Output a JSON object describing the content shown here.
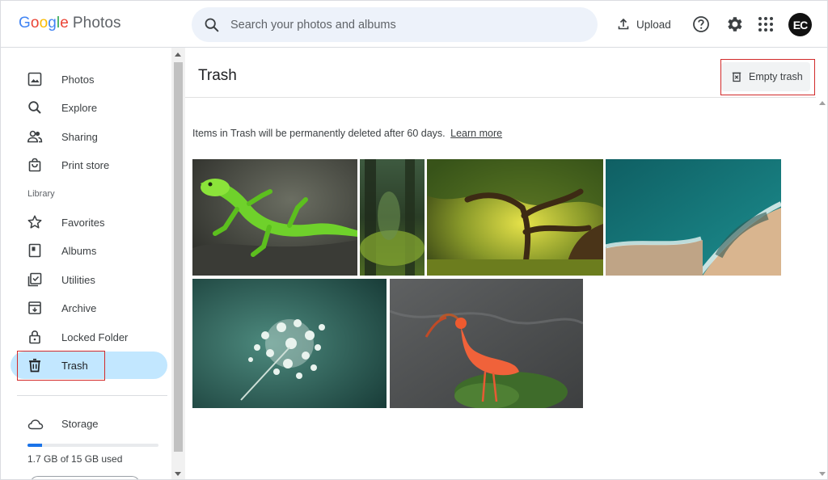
{
  "app": {
    "logo_letters": [
      "G",
      "o",
      "o",
      "g",
      "l",
      "e"
    ],
    "product": "Photos"
  },
  "header": {
    "search_placeholder": "Search your photos and albums",
    "upload_label": "Upload",
    "icons": [
      "search-icon",
      "upload-icon",
      "help-icon",
      "settings-icon",
      "apps-grid-icon"
    ],
    "avatar_initials": "EC"
  },
  "sidebar": {
    "items": [
      {
        "label": "Photos",
        "icon": "photos-icon"
      },
      {
        "label": "Explore",
        "icon": "search-icon"
      },
      {
        "label": "Sharing",
        "icon": "people-icon"
      },
      {
        "label": "Print store",
        "icon": "shopping-bag-icon"
      }
    ],
    "library_heading": "Library",
    "library_items": [
      {
        "label": "Favorites",
        "icon": "star-icon"
      },
      {
        "label": "Albums",
        "icon": "album-icon"
      },
      {
        "label": "Utilities",
        "icon": "checklist-icon"
      },
      {
        "label": "Archive",
        "icon": "archive-icon"
      },
      {
        "label": "Locked Folder",
        "icon": "lock-icon"
      },
      {
        "label": "Trash",
        "icon": "trash-icon",
        "active": true
      }
    ],
    "storage": {
      "label": "Storage",
      "used_text": "1.7 GB of 15 GB used",
      "used_fraction": 0.113
    }
  },
  "main": {
    "title": "Trash",
    "empty_trash_label": "Empty trash",
    "notice": "Items in Trash will be permanently deleted after 60 days.",
    "learn_more": "Learn more",
    "photos": [
      {
        "subject": "green-lizard"
      },
      {
        "subject": "mossy-forest"
      },
      {
        "subject": "large-tree"
      },
      {
        "subject": "aerial-beach"
      },
      {
        "subject": "white-flower"
      },
      {
        "subject": "scarlet-ibis"
      }
    ]
  },
  "colors": {
    "accent_active": "#c2e7ff",
    "highlight_box": "#d22a2a",
    "search_bg": "#edf2fa",
    "storage_fill": "#1a73e8"
  }
}
